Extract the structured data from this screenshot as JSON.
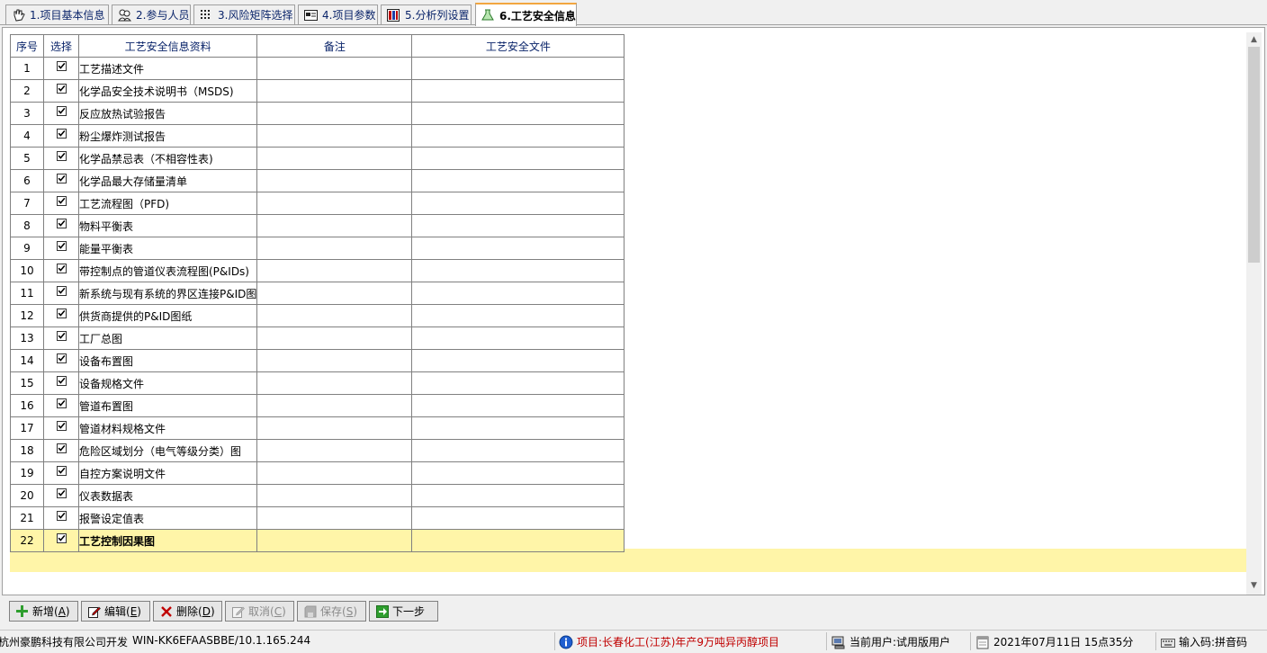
{
  "tabs": [
    {
      "label": "1.项目基本信息",
      "icon": "hand-icon"
    },
    {
      "label": "2.参与人员",
      "icon": "people-icon"
    },
    {
      "label": "3.风险矩阵选择",
      "icon": "matrix-icon"
    },
    {
      "label": "4.项目参数",
      "icon": "card-icon"
    },
    {
      "label": "5.分析列设置",
      "icon": "columns-icon"
    },
    {
      "label": "6.工艺安全信息",
      "icon": "flask-icon",
      "active": true
    }
  ],
  "grid": {
    "headers": {
      "idx": "序号",
      "sel": "选择",
      "name": "工艺安全信息资料",
      "remark": "备注",
      "file": "工艺安全文件"
    },
    "rows": [
      {
        "idx": "1",
        "name": "工艺描述文件",
        "checked": true
      },
      {
        "idx": "2",
        "name": "化学品安全技术说明书（MSDS)",
        "checked": true
      },
      {
        "idx": "3",
        "name": "反应放热试验报告",
        "checked": true
      },
      {
        "idx": "4",
        "name": "粉尘爆炸测试报告",
        "checked": true
      },
      {
        "idx": "5",
        "name": "化学品禁忌表（不相容性表)",
        "checked": true
      },
      {
        "idx": "6",
        "name": "化学品最大存储量清单",
        "checked": true
      },
      {
        "idx": "7",
        "name": "工艺流程图（PFD)",
        "checked": true
      },
      {
        "idx": "8",
        "name": "物料平衡表",
        "checked": true
      },
      {
        "idx": "9",
        "name": "能量平衡表",
        "checked": true
      },
      {
        "idx": "10",
        "name": "带控制点的管道仪表流程图(P&IDs)",
        "checked": true
      },
      {
        "idx": "11",
        "name": "新系统与现有系统的界区连接P&ID图",
        "checked": true
      },
      {
        "idx": "12",
        "name": "供货商提供的P&ID图纸",
        "checked": true
      },
      {
        "idx": "13",
        "name": "工厂总图",
        "checked": true
      },
      {
        "idx": "14",
        "name": "设备布置图",
        "checked": true
      },
      {
        "idx": "15",
        "name": "设备规格文件",
        "checked": true
      },
      {
        "idx": "16",
        "name": "管道布置图",
        "checked": true
      },
      {
        "idx": "17",
        "name": "管道材料规格文件",
        "checked": true
      },
      {
        "idx": "18",
        "name": "危险区域划分（电气等级分类）图",
        "checked": true
      },
      {
        "idx": "19",
        "name": "自控方案说明文件",
        "checked": true
      },
      {
        "idx": "20",
        "name": "仪表数据表",
        "checked": true
      },
      {
        "idx": "21",
        "name": "报警设定值表",
        "checked": true
      },
      {
        "idx": "22",
        "name": "工艺控制因果图",
        "checked": true,
        "selected": true
      }
    ]
  },
  "buttons": {
    "add": {
      "label": "新增(",
      "key": "A",
      "suffix": ")"
    },
    "edit": {
      "label": "编辑(",
      "key": "E",
      "suffix": ")"
    },
    "delete": {
      "label": "删除(",
      "key": "D",
      "suffix": ")"
    },
    "cancel": {
      "label": "取消(",
      "key": "C",
      "suffix": ")"
    },
    "save": {
      "label": "保存(",
      "key": "S",
      "suffix": ")"
    },
    "next": {
      "label": "下一步"
    }
  },
  "status": {
    "company": "杭州豪鹏科技有限公司开发",
    "machine": "WIN-KK6EFAASBBE/10.1.165.244",
    "project": "项目:长春化工(江苏)年产9万吨异丙醇项目",
    "user": "当前用户:试用版用户",
    "datetime": "2021年07月11日  15点35分",
    "input_method": "输入码:拼音码"
  },
  "colors": {
    "selected_row": "#fff5a8",
    "active_tab_accent": "#f2a640",
    "project_text": "#c00000"
  }
}
